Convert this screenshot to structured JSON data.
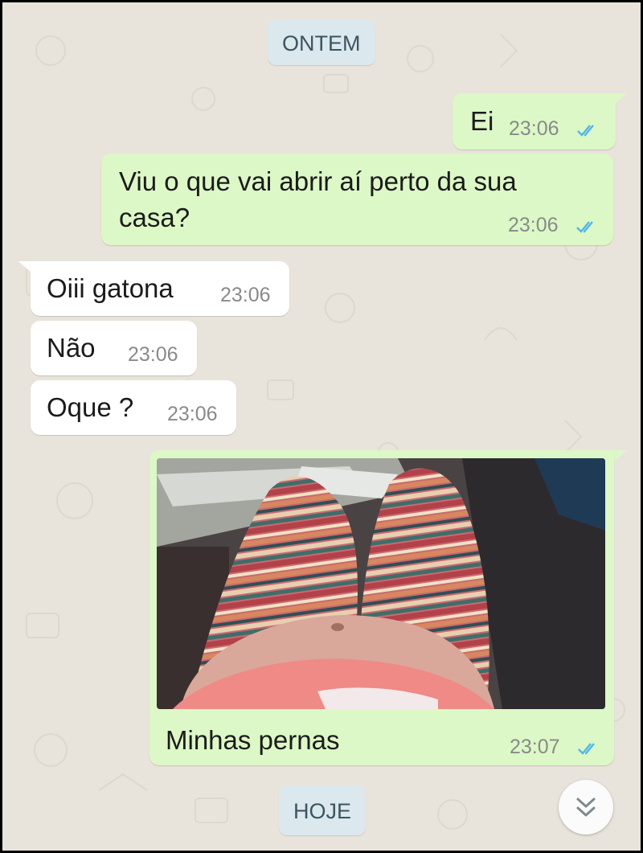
{
  "chat": {
    "date_yesterday": "ONTEM",
    "date_today": "HOJE",
    "messages": [
      {
        "direction": "out",
        "text": "Ei",
        "time": "23:06",
        "status": "read"
      },
      {
        "direction": "out",
        "text_line1": "Viu o que vai abrir aí perto da sua",
        "text_line2": "casa?",
        "time": "23:06",
        "status": "read"
      },
      {
        "direction": "in",
        "text": "Oiii gatona",
        "time": "23:06"
      },
      {
        "direction": "in",
        "text": "Não",
        "time": "23:06"
      },
      {
        "direction": "in",
        "text": "Oque ?",
        "time": "23:06"
      },
      {
        "direction": "out",
        "type": "image",
        "caption": "Minhas pernas",
        "time": "23:07",
        "status": "read"
      }
    ]
  },
  "icons": {
    "read_receipt": "double-check-icon",
    "scroll_down": "double-chevron-down-icon"
  },
  "colors": {
    "background": "#e9e4db",
    "outgoing_bubble": "#dcf8c6",
    "incoming_bubble": "#ffffff",
    "read_tick": "#4fb6ec",
    "date_chip": "#dbe8ee"
  }
}
